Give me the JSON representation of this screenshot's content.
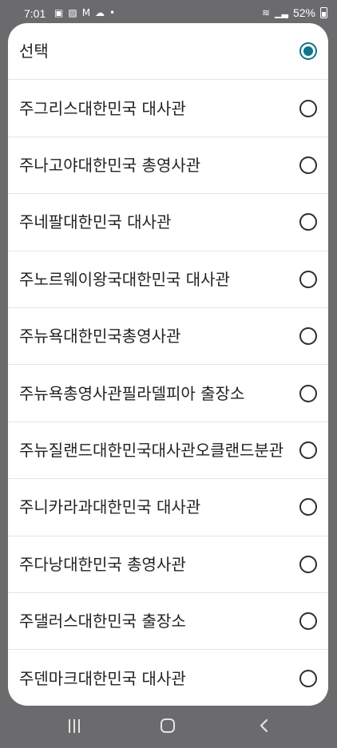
{
  "status_bar": {
    "time": "7:01",
    "left_icons": [
      "gallery-icon",
      "image-icon",
      "gmail-icon",
      "cloud-icon",
      "dot-icon"
    ],
    "battery": "52%",
    "right_icons": [
      "wifi-icon",
      "signal-icon",
      "battery-icon"
    ]
  },
  "dialog": {
    "options": [
      {
        "label": "선택",
        "selected": true
      },
      {
        "label": "주그리스대한민국 대사관",
        "selected": false
      },
      {
        "label": "주나고야대한민국 총영사관",
        "selected": false
      },
      {
        "label": "주네팔대한민국 대사관",
        "selected": false
      },
      {
        "label": "주노르웨이왕국대한민국 대사관",
        "selected": false
      },
      {
        "label": "주뉴욕대한민국총영사관",
        "selected": false
      },
      {
        "label": "주뉴욕총영사관필라델피아 출장소",
        "selected": false
      },
      {
        "label": "주뉴질랜드대한민국대사관오클랜드분관",
        "selected": false
      },
      {
        "label": "주니카라과대한민국 대사관",
        "selected": false
      },
      {
        "label": "주다낭대한민국 총영사관",
        "selected": false
      },
      {
        "label": "주댈러스대한민국 출장소",
        "selected": false
      },
      {
        "label": "주덴마크대한민국 대사관",
        "selected": false
      }
    ]
  },
  "nav_bar": {
    "buttons": [
      "recent-apps",
      "home",
      "back"
    ]
  },
  "colors": {
    "accent": "#10748a",
    "backdrop": "#6b6b6e",
    "sheet": "#ffffff",
    "text": "#222222"
  }
}
